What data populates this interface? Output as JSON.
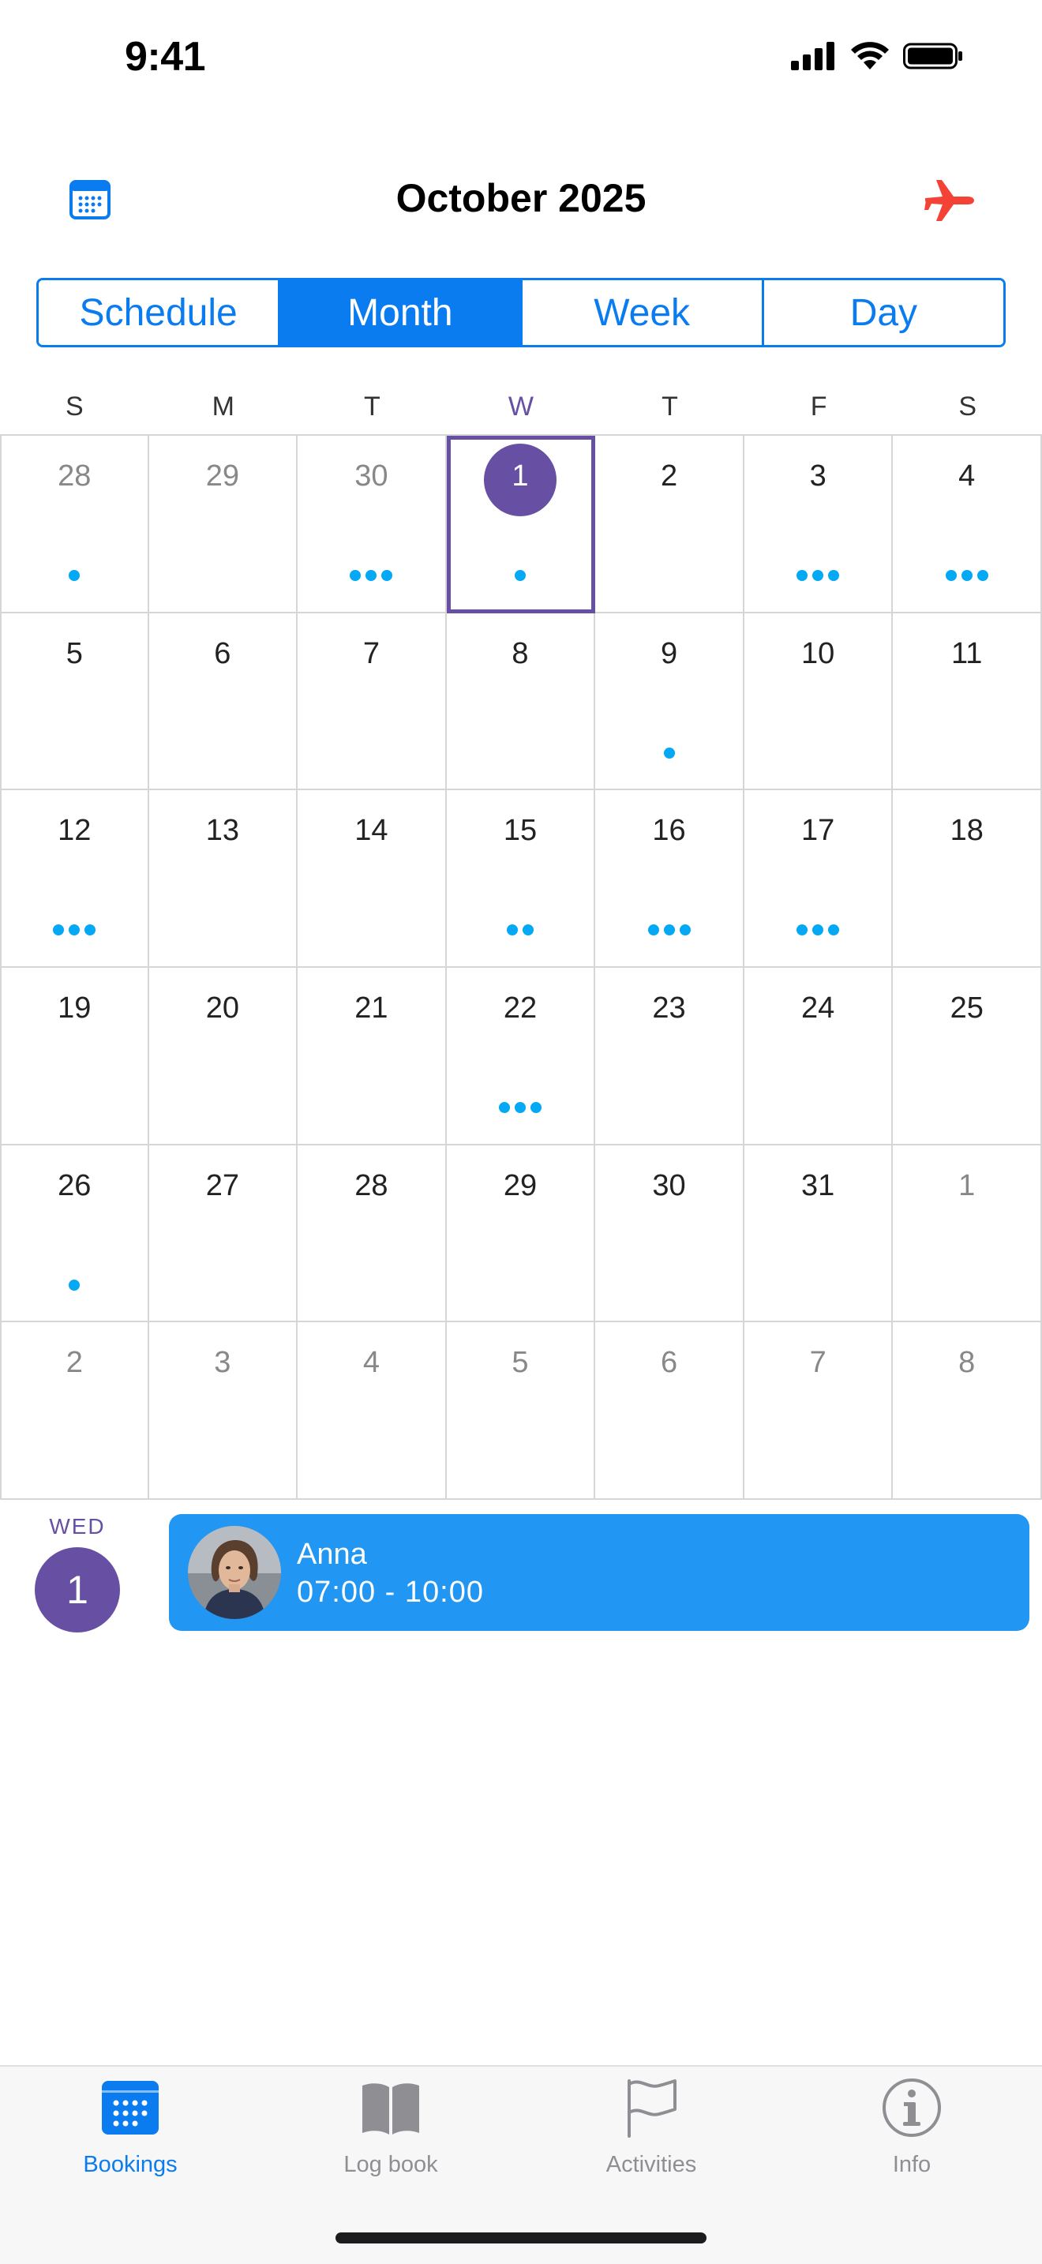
{
  "status_bar": {
    "time": "9:41",
    "icons": [
      "signal-icon",
      "wifi-icon",
      "battery-icon"
    ]
  },
  "header": {
    "title": "October 2025",
    "left_icon": "calendar-icon",
    "right_icon": "airplane-icon"
  },
  "view_tabs": [
    "Schedule",
    "Month",
    "Week",
    "Day"
  ],
  "active_view": "Month",
  "weekdays": [
    "S",
    "M",
    "T",
    "W",
    "T",
    "F",
    "S"
  ],
  "today_weekday_index": 3,
  "calendar": {
    "weeks": [
      [
        {
          "day": "28",
          "other": true,
          "dots": 1
        },
        {
          "day": "29",
          "other": true,
          "dots": 0
        },
        {
          "day": "30",
          "other": true,
          "dots": 3
        },
        {
          "day": "1",
          "other": false,
          "dots": 1,
          "selected": true
        },
        {
          "day": "2",
          "other": false,
          "dots": 0
        },
        {
          "day": "3",
          "other": false,
          "dots": 3
        },
        {
          "day": "4",
          "other": false,
          "dots": 3
        }
      ],
      [
        {
          "day": "5",
          "other": false,
          "dots": 0
        },
        {
          "day": "6",
          "other": false,
          "dots": 0
        },
        {
          "day": "7",
          "other": false,
          "dots": 0
        },
        {
          "day": "8",
          "other": false,
          "dots": 0
        },
        {
          "day": "9",
          "other": false,
          "dots": 1
        },
        {
          "day": "10",
          "other": false,
          "dots": 0
        },
        {
          "day": "11",
          "other": false,
          "dots": 0
        }
      ],
      [
        {
          "day": "12",
          "other": false,
          "dots": 3
        },
        {
          "day": "13",
          "other": false,
          "dots": 0
        },
        {
          "day": "14",
          "other": false,
          "dots": 0
        },
        {
          "day": "15",
          "other": false,
          "dots": 2
        },
        {
          "day": "16",
          "other": false,
          "dots": 3
        },
        {
          "day": "17",
          "other": false,
          "dots": 3
        },
        {
          "day": "18",
          "other": false,
          "dots": 0
        }
      ],
      [
        {
          "day": "19",
          "other": false,
          "dots": 0
        },
        {
          "day": "20",
          "other": false,
          "dots": 0
        },
        {
          "day": "21",
          "other": false,
          "dots": 0
        },
        {
          "day": "22",
          "other": false,
          "dots": 3
        },
        {
          "day": "23",
          "other": false,
          "dots": 0
        },
        {
          "day": "24",
          "other": false,
          "dots": 0
        },
        {
          "day": "25",
          "other": false,
          "dots": 0
        }
      ],
      [
        {
          "day": "26",
          "other": false,
          "dots": 1
        },
        {
          "day": "27",
          "other": false,
          "dots": 0
        },
        {
          "day": "28",
          "other": false,
          "dots": 0
        },
        {
          "day": "29",
          "other": false,
          "dots": 0
        },
        {
          "day": "30",
          "other": false,
          "dots": 0
        },
        {
          "day": "31",
          "other": false,
          "dots": 0
        },
        {
          "day": "1",
          "other": true,
          "dots": 0
        }
      ],
      [
        {
          "day": "2",
          "other": true,
          "dots": 0
        },
        {
          "day": "3",
          "other": true,
          "dots": 0
        },
        {
          "day": "4",
          "other": true,
          "dots": 0
        },
        {
          "day": "5",
          "other": true,
          "dots": 0
        },
        {
          "day": "6",
          "other": true,
          "dots": 0
        },
        {
          "day": "7",
          "other": true,
          "dots": 0
        },
        {
          "day": "8",
          "other": true,
          "dots": 0
        }
      ]
    ]
  },
  "agenda": {
    "weekday": "WED",
    "date": "1",
    "event": {
      "name": "Anna",
      "time": "07:00 - 10:00",
      "avatar": "avatar-photo"
    }
  },
  "tab_bar": [
    {
      "label": "Bookings",
      "icon": "calendar-grid-icon",
      "active": true
    },
    {
      "label": "Log book",
      "icon": "book-icon",
      "active": false
    },
    {
      "label": "Activities",
      "icon": "flag-icon",
      "active": false
    },
    {
      "label": "Info",
      "icon": "info-icon",
      "active": false
    }
  ],
  "colors": {
    "accent": "#0a7cf0",
    "selected": "#6750a4",
    "dot": "#03a9f4",
    "event": "#2196f3",
    "plane": "#f44336"
  }
}
